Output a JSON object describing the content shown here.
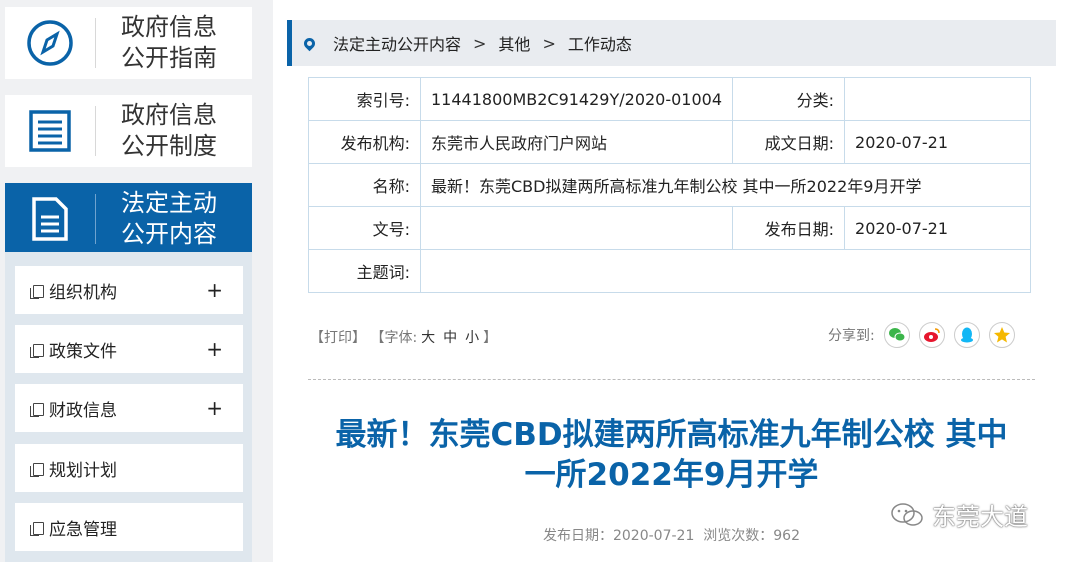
{
  "sidebar": {
    "cards": [
      {
        "line1": "政府信息",
        "line2": "公开指南",
        "icon": "compass-icon"
      },
      {
        "line1": "政府信息",
        "line2": "公开制度",
        "icon": "list-icon"
      },
      {
        "line1": "法定主动",
        "line2": "公开内容",
        "icon": "document-icon"
      }
    ],
    "menu": [
      {
        "label": "组织机构",
        "expand": "+"
      },
      {
        "label": "政策文件",
        "expand": "+"
      },
      {
        "label": "财政信息",
        "expand": "+"
      },
      {
        "label": "规划计划",
        "expand": ""
      },
      {
        "label": "应急管理",
        "expand": ""
      }
    ]
  },
  "breadcrumb": {
    "items": [
      "法定主动公开内容",
      "其他",
      "工作动态"
    ],
    "separator": ">"
  },
  "meta": {
    "index_label": "索引号:",
    "index_value": "11441800MB2C91429Y/2020-01004",
    "category_label": "分类:",
    "category_value": "",
    "publisher_label": "发布机构:",
    "publisher_value": "东莞市人民政府门户网站",
    "written_date_label": "成文日期:",
    "written_date_value": "2020-07-21",
    "name_label": "名称:",
    "name_value": "最新！东莞CBD拟建两所高标准九年制公校 其中一所2022年9月开学",
    "doc_no_label": "文号:",
    "doc_no_value": "",
    "publish_date_label": "发布日期:",
    "publish_date_value": "2020-07-21",
    "keywords_label": "主题词:",
    "keywords_value": ""
  },
  "tools": {
    "print": "【打印】",
    "font_prefix": "【字体:",
    "font_large": "大",
    "font_medium": "中",
    "font_small": "小",
    "font_suffix": "】",
    "share_label": "分享到:"
  },
  "article": {
    "title_line1": "最新！东莞CBD拟建两所高标准九年制公校 其中",
    "title_line2": "一所2022年9月开学",
    "pub_label": "发布日期：",
    "pub_date": "2020-07-21",
    "views_label": "浏览次数：",
    "views": "962"
  },
  "watermark": {
    "text": "东莞大道"
  },
  "colors": {
    "accent": "#0a63a8",
    "wechat": "#3bb54a",
    "weibo": "#e6162d",
    "qq": "#12b7f5",
    "qzone": "#f5b800"
  }
}
